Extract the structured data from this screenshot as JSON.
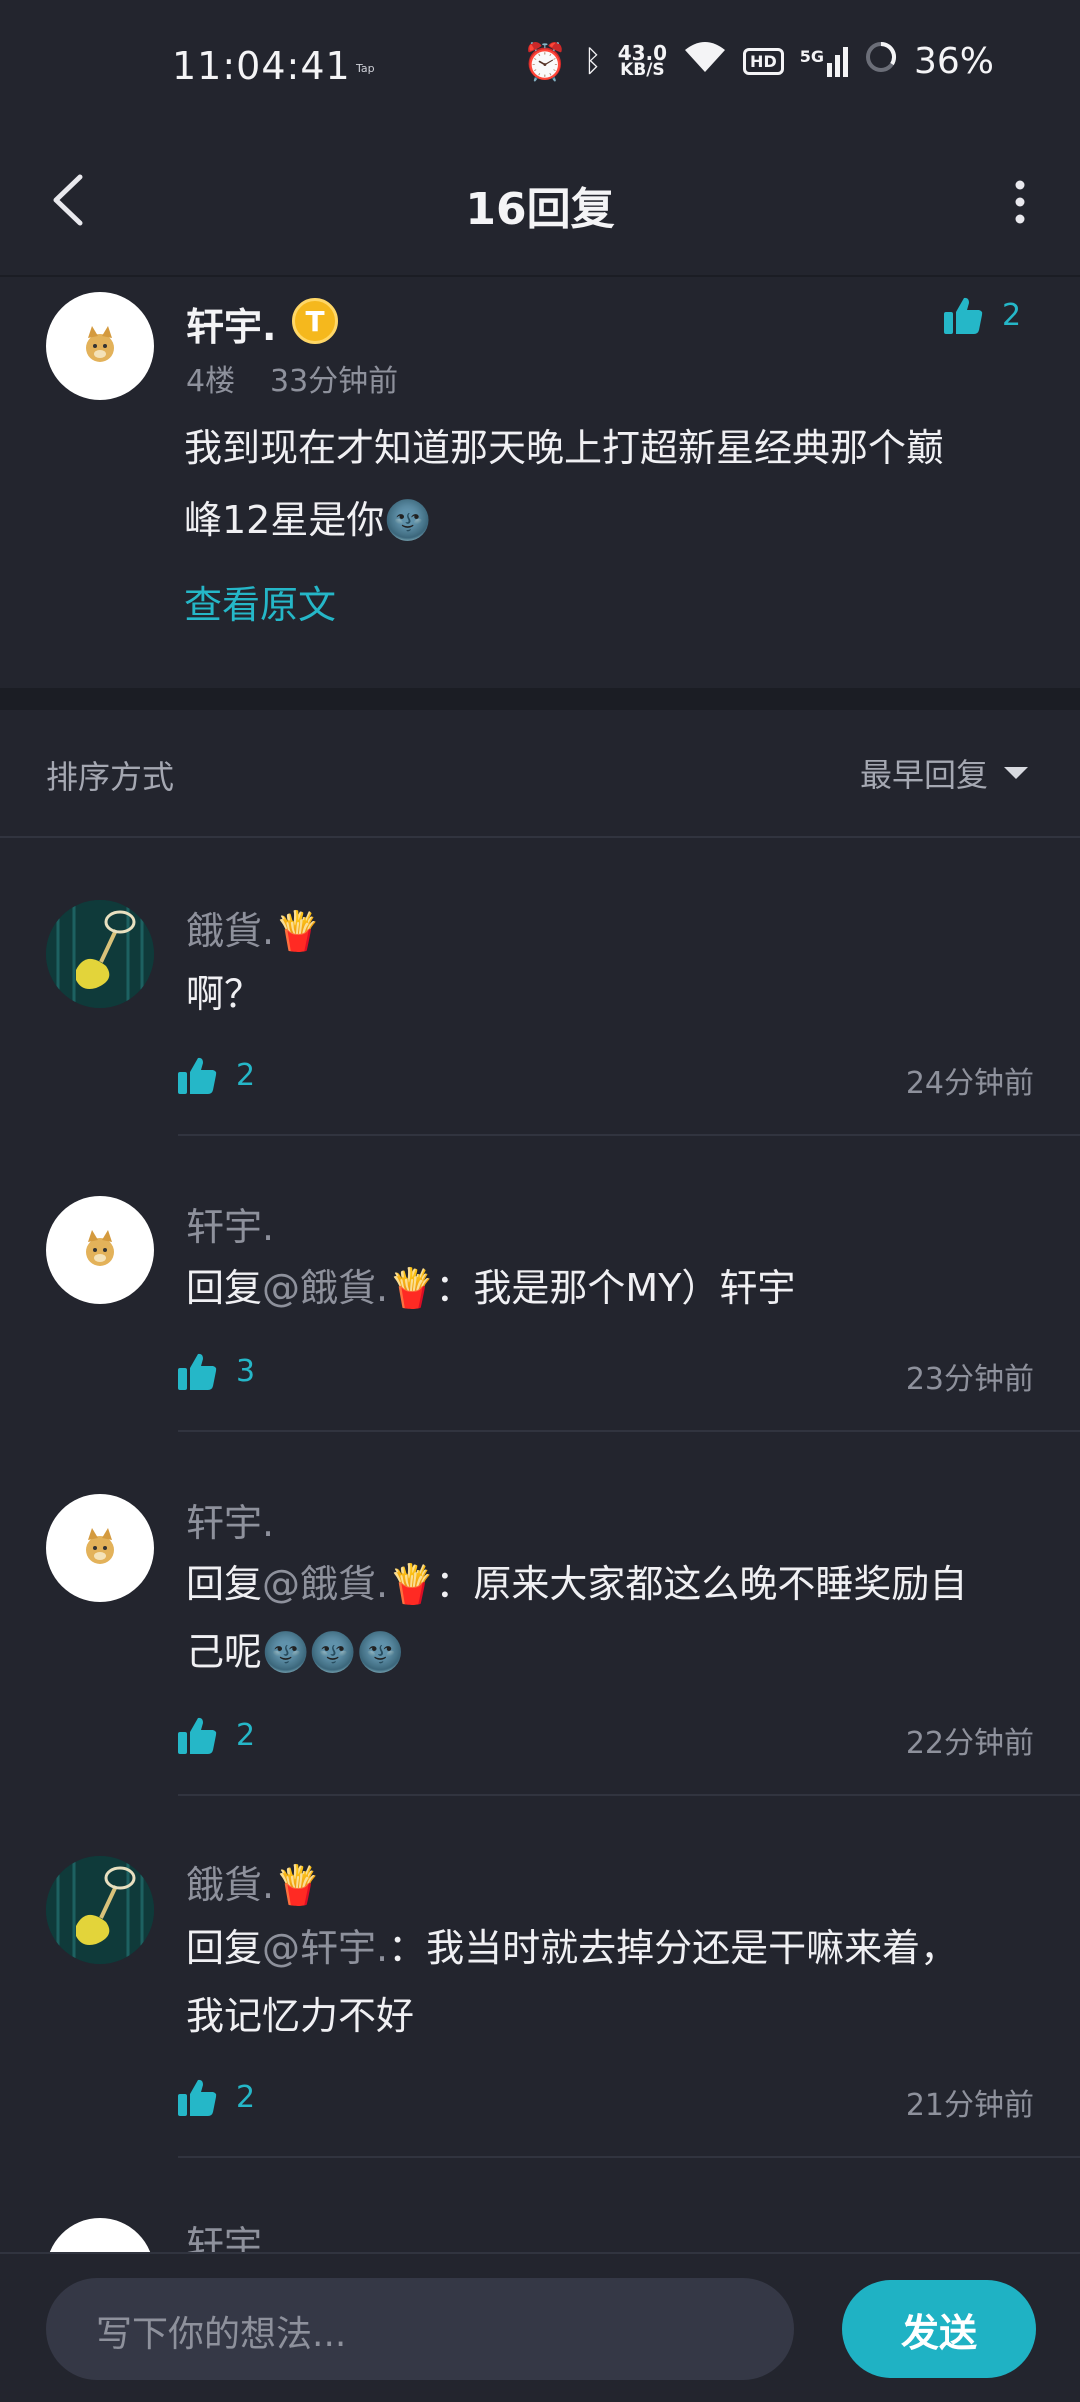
{
  "status_bar": {
    "time": "11:04:41",
    "tap": "Tap",
    "net_speed_value": "43.0",
    "net_speed_unit": "KB/S",
    "hd": "HD",
    "signal": "5G",
    "battery": "36%"
  },
  "nav": {
    "title": "16回复"
  },
  "post": {
    "author": "轩宇.",
    "badge": "T",
    "floor": "4楼",
    "time": "33分钟前",
    "likes": "2",
    "body_line1": "我到现在才知道那天晚上打超新星经典那个巅",
    "body_line2": "峰12星是你🌚",
    "view_original": "查看原文"
  },
  "sort": {
    "label": "排序方式",
    "value": "最早回复"
  },
  "comments": [
    {
      "author": "餓貨.🍟",
      "text": "啊？",
      "likes": "2",
      "time": "24分钟前"
    },
    {
      "author": "轩宇.",
      "prefix": "回复",
      "mention": "@餓貨.🍟",
      "text": "：我是那个MY）轩宇",
      "likes": "3",
      "time": "23分钟前"
    },
    {
      "author": "轩宇.",
      "prefix": "回复",
      "mention": "@餓貨.🍟",
      "text": "：原来大家都这么晚不睡奖励自",
      "text2": "己呢🌚🌚🌚",
      "likes": "2",
      "time": "22分钟前"
    },
    {
      "author": "餓貨.🍟",
      "prefix": "回复",
      "mention": "@轩宇.",
      "text": "：我当时就去掉分还是干嘛来着，",
      "text2": "我记忆力不好",
      "likes": "2",
      "time": "21分钟前"
    },
    {
      "author": "轩宇."
    }
  ],
  "composer": {
    "placeholder": "写下你的想法...",
    "send": "发送"
  },
  "colors": {
    "accent": "#1fb2c4",
    "background": "#23252e"
  }
}
